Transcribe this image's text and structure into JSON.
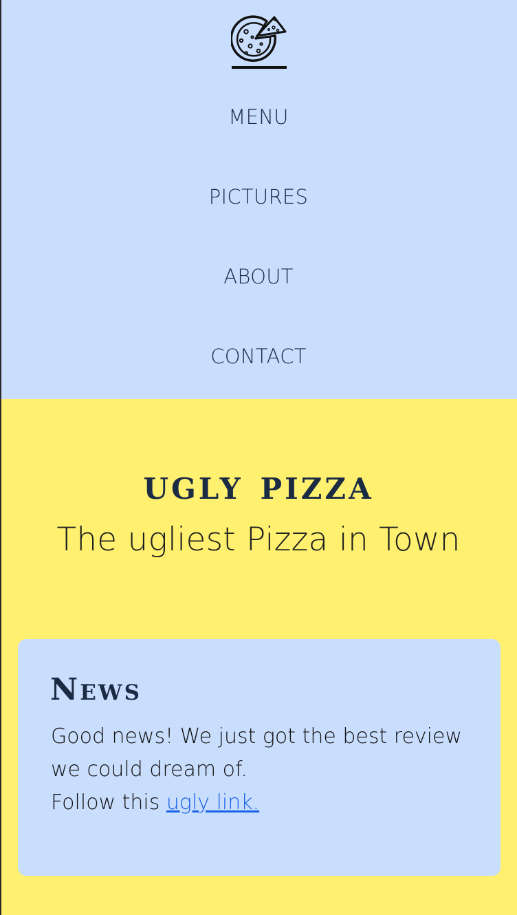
{
  "nav": {
    "logo_icon": "pizza-icon",
    "items": [
      {
        "label": "MENU"
      },
      {
        "label": "PICTURES"
      },
      {
        "label": "ABOUT"
      },
      {
        "label": "CONTACT"
      }
    ]
  },
  "hero": {
    "title": "ugly pizza",
    "subtitle": "The ugliest Pizza in Town"
  },
  "news": {
    "heading": "News",
    "text_line1": "Good news! We just got the best review we could dream of.",
    "text_line2_prefix": "Follow this ",
    "link_text": "ugly link."
  },
  "colors": {
    "nav_background": "#c9ddfd",
    "page_background": "#fff16f",
    "heading_color": "#1c2b44",
    "link_color": "#1a63e6"
  }
}
